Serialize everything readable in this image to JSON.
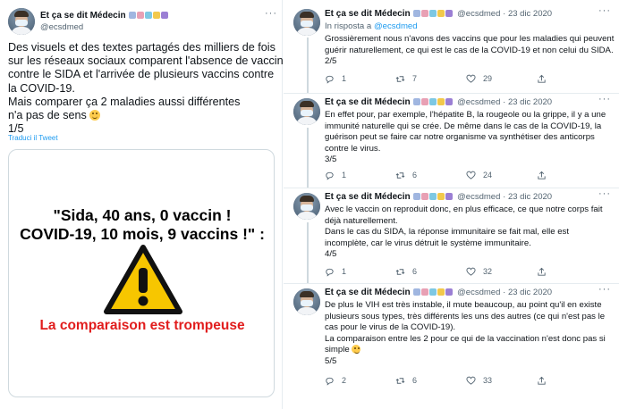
{
  "author": {
    "name": "Et ça se dit Médecin",
    "handle": "@ecsdmed",
    "emoji_colors": [
      "#a0b6e0",
      "#e8a0b4",
      "#7ec8e3",
      "#f2c94c",
      "#9b7fd4"
    ]
  },
  "left_tweet": {
    "lines": [
      "Des visuels et des textes partagés des milliers de fois",
      "sur les réseaux sociaux comparent l'absence de vaccin",
      "contre le SIDA et l'arrivée de plusieurs vaccins contre",
      "la COVID-19.",
      "Mais comparer ça 2 maladies aussi différentes",
      "n'a pas de sens",
      "1/5"
    ],
    "translate_label": "Traduci il Tweet",
    "media": {
      "quote_line1": "\"Sida, 40 ans, 0 vaccin !",
      "quote_line2": "COVID-19, 10 mois, 9 vaccins !\" :",
      "caption": "La comparaison est trompeuse",
      "warning_icon": "warning-triangle-icon"
    }
  },
  "thread": [
    {
      "date": "· 23 dic 2020",
      "reply_to_label": "In risposta a",
      "reply_to_handle": "@ecsdmed",
      "lines": [
        "Grossièrement nous n'avons des vaccins que pour les maladies qui peuvent",
        "guérir naturellement, ce qui est le cas de la COVID-19 et non celui du SIDA.",
        "2/5"
      ],
      "counts": {
        "reply": "1",
        "retweet": "7",
        "like": "29"
      }
    },
    {
      "date": "· 23 dic 2020",
      "lines": [
        "En effet pour, par exemple, l'hépatite B, la rougeole ou la grippe, il y a une",
        "immunité naturelle qui se crée. De même dans le cas de la COVID-19, la",
        "guérison peut se faire car notre organisme va synthétiser des anticorps",
        "contre le virus.",
        "3/5"
      ],
      "counts": {
        "reply": "1",
        "retweet": "6",
        "like": "24"
      }
    },
    {
      "date": "· 23 dic 2020",
      "lines": [
        "Avec le vaccin on reproduit donc, en plus efficace, ce que notre corps fait",
        "déjà naturellement.",
        "Dans le cas du SIDA, la réponse immunitaire se fait mal, elle est",
        "incomplète, car le virus détruit le système immunitaire.",
        "4/5"
      ],
      "counts": {
        "reply": "1",
        "retweet": "6",
        "like": "32"
      }
    },
    {
      "date": "· 23 dic 2020",
      "lines": [
        "De plus le VIH est très instable, il mute beaucoup, au point qu'il en existe",
        "plusieurs sous types, très différents les uns des autres (ce qui n'est pas le",
        "cas pour le virus de la COVID-19).",
        "La comparaison entre les 2 pour ce qui de la vaccination n'est donc pas si",
        "simple",
        "5/5"
      ],
      "counts": {
        "reply": "2",
        "retweet": "6",
        "like": "33"
      }
    }
  ],
  "colors": {
    "link": "#1d9bf0",
    "caption_red": "#e11d1d",
    "warning_yellow": "#f7c600",
    "muted": "#536471"
  }
}
